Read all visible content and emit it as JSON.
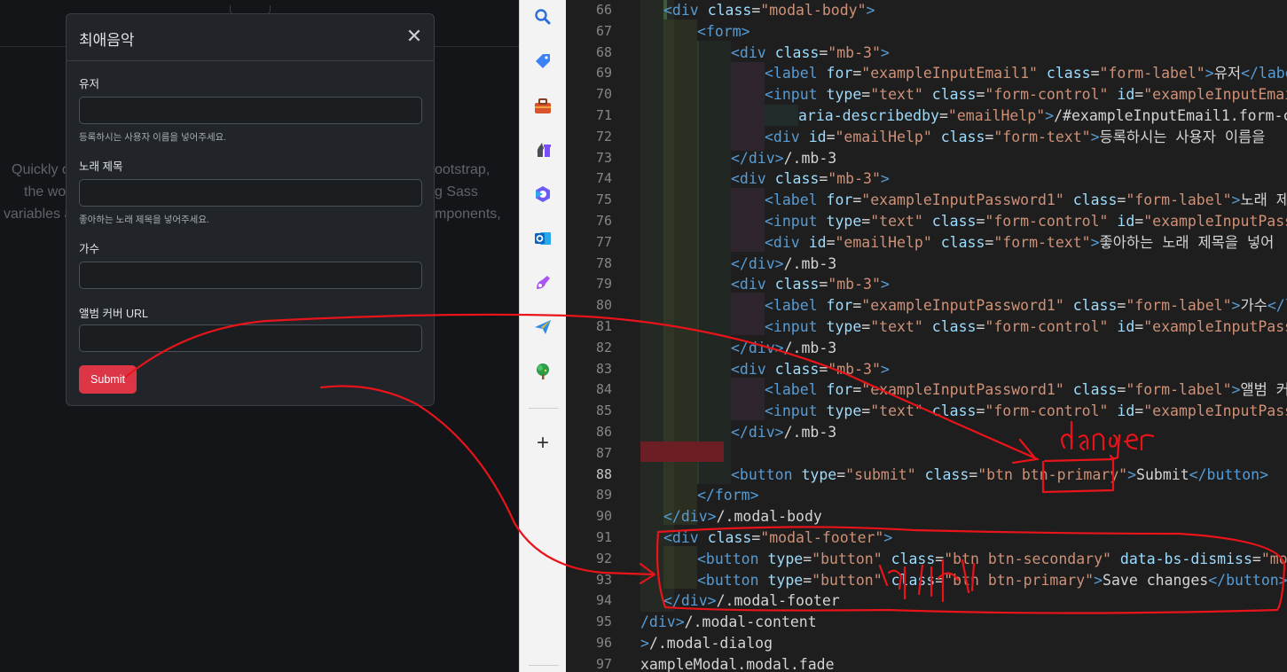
{
  "background_page": {
    "line1_left": "Quickly c",
    "line1_right": "ootstrap,",
    "line2_left": "the wo",
    "line2_right": "g Sass",
    "line3_left": "variables a",
    "line3_right": "mponents,"
  },
  "modal": {
    "title": "최애음악",
    "close_glyph": "✕",
    "fields": [
      {
        "label": "유저",
        "value": "",
        "help": "등록하시는 사용자 이름을 넣어주세요."
      },
      {
        "label": "노래 제목",
        "value": "",
        "help": "좋아하는 노래 제목을 넣어주세요."
      },
      {
        "label": "가수",
        "value": "",
        "help": ""
      },
      {
        "label": "앨범 커버 URL",
        "value": "",
        "help": ""
      }
    ],
    "submit_label": "Submit",
    "submit_color": "#dc3545"
  },
  "sidebar": {
    "icons": [
      "search-icon",
      "tag-icon",
      "toolbox-icon",
      "chess-icon",
      "copilot-icon",
      "outlook-icon",
      "designer-icon",
      "send-icon",
      "tree-icon"
    ],
    "add_glyph": "+"
  },
  "editor": {
    "line_numbers": [
      "66",
      "67",
      "68",
      "69",
      "70",
      "71",
      "72",
      "73",
      "74",
      "75",
      "76",
      "77",
      "78",
      "79",
      "80",
      "81",
      "82",
      "83",
      "84",
      "85",
      "86",
      "87",
      "88",
      "89",
      "90",
      "91",
      "92",
      "93",
      "94",
      "95",
      "96",
      "97"
    ],
    "active_line": "88"
  },
  "annotations": {
    "handwritten_note_1": "danger",
    "handwritten_note_2": "삭제"
  }
}
